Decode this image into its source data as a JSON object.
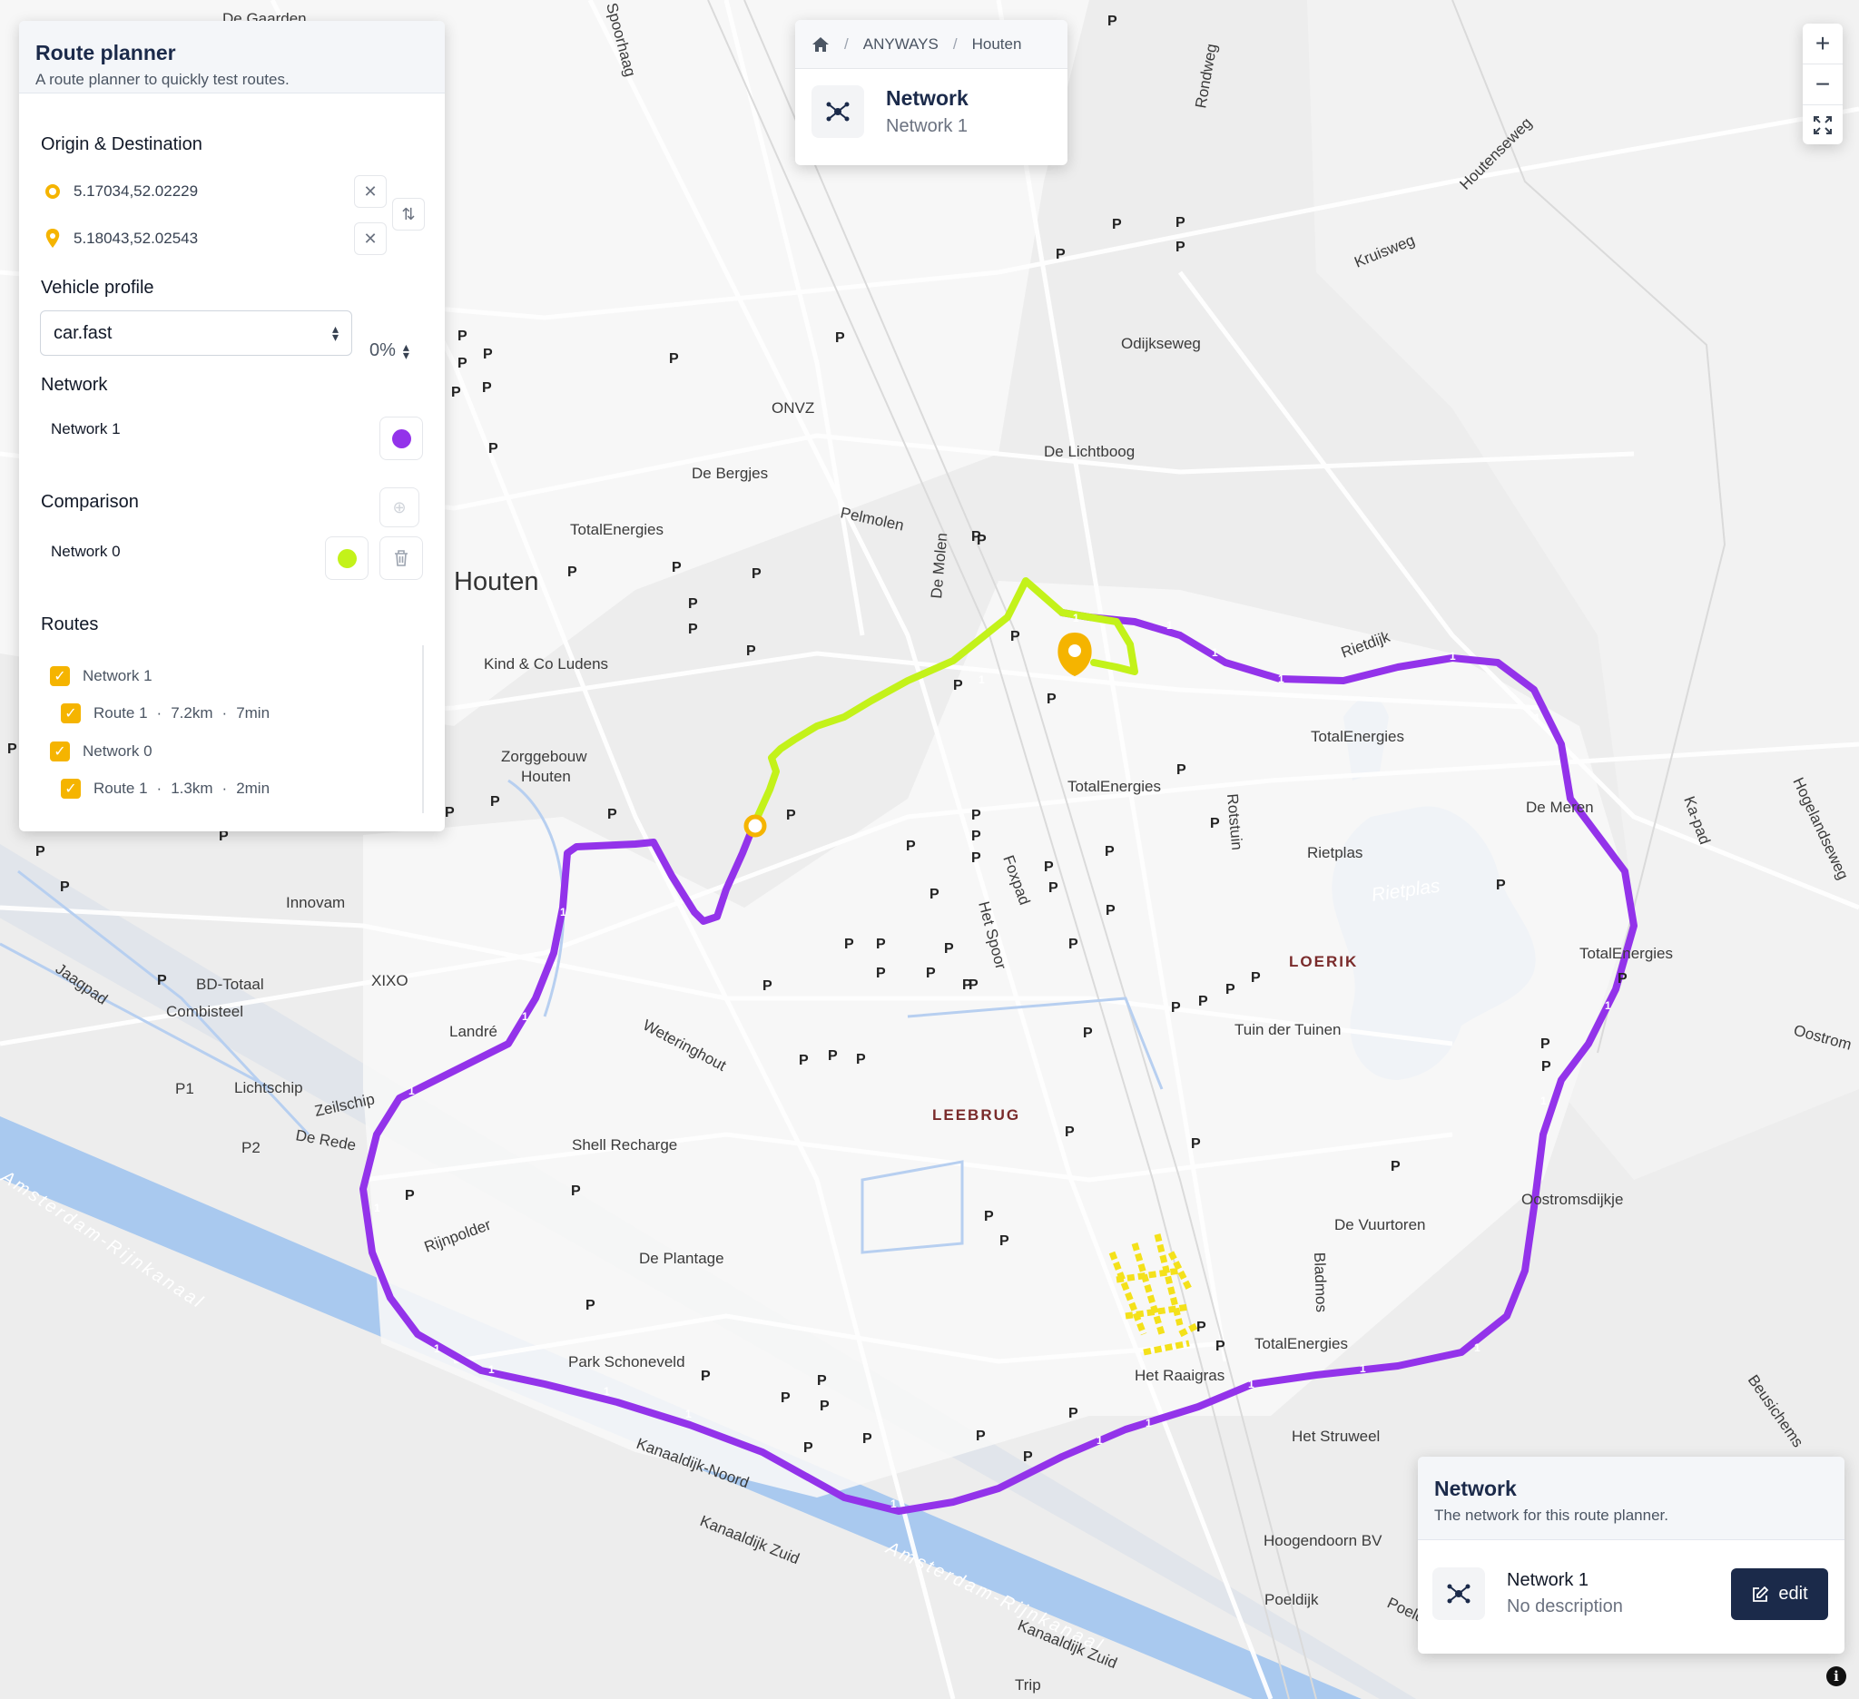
{
  "map": {
    "labels": {
      "houten": "Houten",
      "onvz": "ONVZ",
      "de_bergjes": "De Bergjes",
      "pelmolen": "Pelmolen",
      "totalenergies_1": "TotalEnergies",
      "de_lichtboog": "De Lichtboog",
      "odijkseweg": "Odijkseweg",
      "kruisweg": "Kruisweg",
      "houtenseweg": "Houtenseweg",
      "rondweg": "Rondweg",
      "rietdijk": "Rietdijk",
      "kind_co": "Kind & Co Ludens",
      "zorggebouw": "Zorggebouw",
      "zorggebouw_2": "Houten",
      "totalenergies_2": "TotalEnergies",
      "totalenergies_3": "TotalEnergies",
      "de_meren": "De Meren",
      "rietplas": "Rietplas",
      "rietplas_water": "Rietplas",
      "loerik": "LOERIK",
      "totalenergies_4": "TotalEnergies",
      "tuin_der_tuinen": "Tuin der Tuinen",
      "innovam": "Innovam",
      "bd_totaal": "BD-Totaal",
      "xixo": "XIXO",
      "combisteel": "Combisteel",
      "lander": "Landré",
      "lichtschip": "Lichtschip",
      "zeilschip": "Zeilschip",
      "de_rede": "De Rede",
      "p1": "P1",
      "p2": "P2",
      "jaagpad": "Jaagpad",
      "leebrug": "LEEBRUG",
      "het_spoor": "Het Spoor",
      "foxpad": "Foxpad",
      "de_molen": "De Molen",
      "rotstuin": "Rotstuin",
      "weteringhout": "Weteringhout",
      "shell": "Shell Recharge",
      "rijnpolder": "Rijnpolder",
      "de_plantage": "De Plantage",
      "park_schoneveld": "Park Schoneveld",
      "de_vuurtoren": "De Vuurtoren",
      "bladmos": "Bladmos",
      "totalenergies_5": "TotalEnergies",
      "het_raaigras": "Het Raaigras",
      "het_struweel": "Het Struweel",
      "oostromsdijkje": "Oostromsdijkje",
      "oostrom": "Oostrom",
      "ka_pad": "Ka-pad",
      "hogelandseweg": "Hogelandseweg",
      "kanaal_1": "Amsterdam-Rijnkanaal",
      "kanaal_2": "Amsterdam-Rijnkanaal",
      "kanaal_3": "Amsterdam-Rijnkanaal",
      "kanaaldijk_noord": "Kanaaldijk-Noord",
      "kanaaldijk_zuid": "Kanaaldijk Zuid",
      "kanaaldijk_zuid_2": "Kanaaldijk Zuid",
      "hoogendoorn": "Hoogendoorn BV",
      "poeldijk": "Poeldijk",
      "poeldijk_2": "Poeldijk",
      "beusichem": "Beusichems",
      "trip": "Trip",
      "de_gaarden": "De Gaarden",
      "spoorhaag": "Spoorhaag"
    },
    "colors": {
      "route_network1": "#9333ea",
      "route_network0": "#c3f21a",
      "origin_marker": "#f5b400",
      "water": "#a9c9ef",
      "highlight_network": "#f4e11a"
    },
    "route_marker_label": "1"
  },
  "breadcrumb": {
    "home_icon": "home-icon",
    "items": [
      "ANYWAYS",
      "Houten"
    ],
    "title": "Network",
    "subtitle": "Network 1"
  },
  "zoom": {
    "in": "+",
    "out": "−",
    "fit_icon": "fullscreen-icon"
  },
  "route_planner": {
    "title": "Route planner",
    "subtitle": "A route planner to quickly test routes.",
    "origin_destination_label": "Origin & Destination",
    "origin": "5.17034,52.02229",
    "destination": "5.18043,52.02543",
    "vehicle_profile_label": "Vehicle profile",
    "vehicle_profile": "car.fast",
    "percentage": "0%",
    "network_label": "Network",
    "network_name": "Network 1",
    "network_color": "#9333ea",
    "comparison_label": "Comparison",
    "comparison_name": "Network 0",
    "comparison_color": "#c3f21a",
    "routes_label": "Routes",
    "routes": [
      {
        "group": "Network 1",
        "route": "Route 1",
        "distance": "7.2km",
        "time": "7min"
      },
      {
        "group": "Network 0",
        "route": "Route 1",
        "distance": "1.3km",
        "time": "2min"
      }
    ],
    "separator": "·"
  },
  "network_panel": {
    "title": "Network",
    "subtitle": "The network for this route planner.",
    "name": "Network 1",
    "description": "No description",
    "edit_label": "edit"
  },
  "info_icon": "i"
}
